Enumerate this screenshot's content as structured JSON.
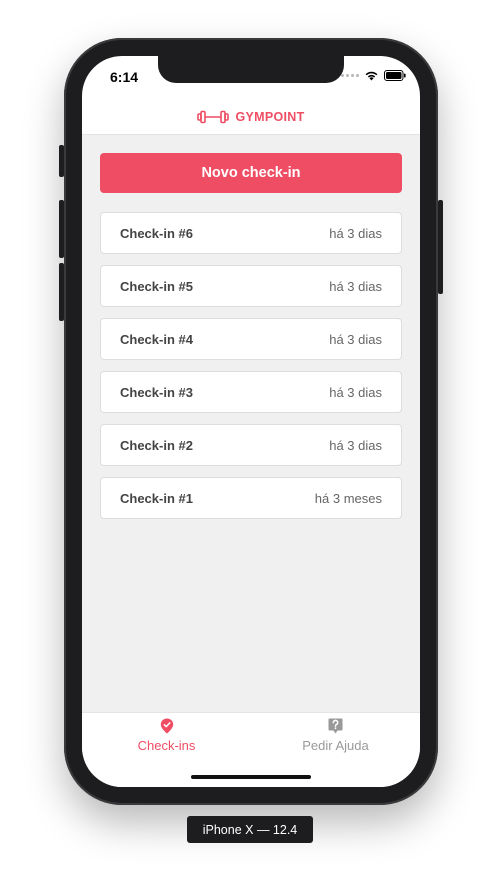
{
  "status_bar": {
    "time": "6:14"
  },
  "header": {
    "brand": "GYMPOINT",
    "logo_icon": "dumbbell-icon"
  },
  "main": {
    "new_checkin_label": "Novo check-in",
    "checkins": [
      {
        "title": "Check-in #6",
        "time": "há 3 dias"
      },
      {
        "title": "Check-in #5",
        "time": "há 3 dias"
      },
      {
        "title": "Check-in #4",
        "time": "há 3 dias"
      },
      {
        "title": "Check-in #3",
        "time": "há 3 dias"
      },
      {
        "title": "Check-in #2",
        "time": "há 3 dias"
      },
      {
        "title": "Check-in #1",
        "time": "há 3 meses"
      }
    ]
  },
  "tabbar": {
    "tabs": [
      {
        "label": "Check-ins",
        "icon": "map-pin-check-icon",
        "active": true
      },
      {
        "label": "Pedir Ajuda",
        "icon": "question-bubble-icon",
        "active": false
      }
    ]
  },
  "device_label": "iPhone X — 12.4",
  "colors": {
    "accent": "#ee4d64",
    "background": "#f0f0f0",
    "inactive": "#999999"
  }
}
